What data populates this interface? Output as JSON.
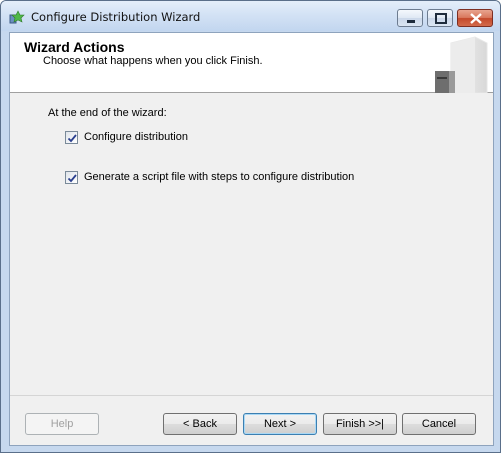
{
  "window": {
    "title": "Configure Distribution Wizard"
  },
  "header": {
    "title": "Wizard Actions",
    "subtitle": "Choose what happens when you click Finish."
  },
  "main": {
    "label": "At the end of the wizard:",
    "options": [
      {
        "label": "Configure distribution",
        "checked": true
      },
      {
        "label": "Generate a script file with steps to configure distribution",
        "checked": true
      }
    ]
  },
  "buttons": {
    "help": "Help",
    "back": "< Back",
    "next": "Next >",
    "finish": "Finish >>|",
    "cancel": "Cancel"
  }
}
